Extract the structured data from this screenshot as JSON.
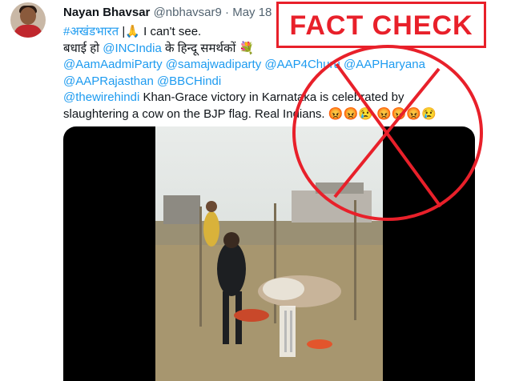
{
  "author": {
    "name": "Nayan Bhavsar",
    "handle": "@nbhavsar9",
    "separator": "·",
    "date": "May 18"
  },
  "more_icon": "⋯",
  "tweet": {
    "line1_tag": "#अखंडभारत",
    "line1_text": " |🙏  I can't see.",
    "line2_prefix": "बधाई हो ",
    "line2_mention": "@INCIndia",
    "line2_suffix": "  के हिन्दू समर्थकों 💐",
    "line3": "@AamAadmiParty @samajwadiparty @AAP4Churu @AAPHaryana",
    "line4": "@AAPRajasthan @BBCHindi",
    "line5_mention": "@thewirehindi",
    "line5_text": " Khan-Grace victory in Karnataka is celebrated by",
    "line6": "slaughtering a cow on the BJP flag.  Real Indians.  😡😡😢  😡😡😡😢"
  },
  "overlay": {
    "label": "FACT CHECK",
    "accent_color": "#e8202a"
  }
}
